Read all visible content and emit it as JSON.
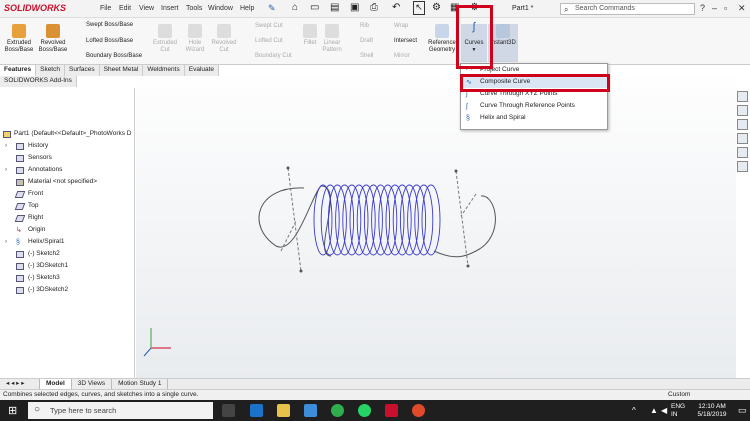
{
  "app": {
    "logo": "SOLIDWORKS",
    "doc_title": "Part1 *",
    "search_placeholder": "Search Commands"
  },
  "menu": [
    "File",
    "Edit",
    "View",
    "Insert",
    "Tools",
    "Window",
    "Help"
  ],
  "ribbon": {
    "extruded": "Extruded Boss/Base",
    "revolved": "Revolved Boss/Base",
    "swept": "Swept Boss/Base",
    "lofted": "Lofted Boss/Base",
    "boundary": "Boundary Boss/Base",
    "extruded_cut": "Extruded Cut",
    "hole_wizard": "Hole Wizard",
    "revolved_cut": "Revolved Cut",
    "swept_cut": "Swept Cut",
    "lofted_cut": "Lofted Cut",
    "boundary_cut": "Boundary Cut",
    "fillet": "Fillet",
    "linear_pattern": "Linear Pattern",
    "rib": "Rib",
    "draft": "Draft",
    "shell": "Shell",
    "wrap": "Wrap",
    "intersect": "Intersect",
    "mirror": "Mirror",
    "reference_geometry": "Reference Geometry",
    "curves": "Curves",
    "instant3d": "Instant3D"
  },
  "tabs": [
    "Features",
    "Sketch",
    "Surfaces",
    "Sheet Metal",
    "Weldments",
    "Evaluate",
    "SOLIDWORKS Add-Ins"
  ],
  "tree": [
    "Part1  (Default<<Default>_PhotoWorks D",
    "History",
    "Sensors",
    "Annotations",
    "Material <not specified>",
    "Front",
    "Top",
    "Right",
    "Origin",
    "Helix/Spiral1",
    "(-) Sketch2",
    "(-) 3DSketch1",
    "(-) Sketch3",
    "(-) 3DSketch2"
  ],
  "curves_menu": [
    "Project Curve",
    "Composite Curve",
    "Curve Through XYZ Points",
    "Curve Through Reference Points",
    "Helix and Spiral"
  ],
  "bottom_tabs": [
    "Model",
    "3D Views",
    "Motion Study 1"
  ],
  "status": {
    "message": "Combines selected edges, curves, and sketches into a single curve.",
    "units": "Custom"
  },
  "taskbar": {
    "search_placeholder": "Type here to search",
    "lang": "ENG",
    "region": "IN",
    "time": "12:10 AM",
    "date": "5/18/2019"
  },
  "colors": {
    "highlight": "#d0021b",
    "helix": "#3a3acf",
    "brand": "#c8102e",
    "taskbar": "#1f1f1f"
  }
}
